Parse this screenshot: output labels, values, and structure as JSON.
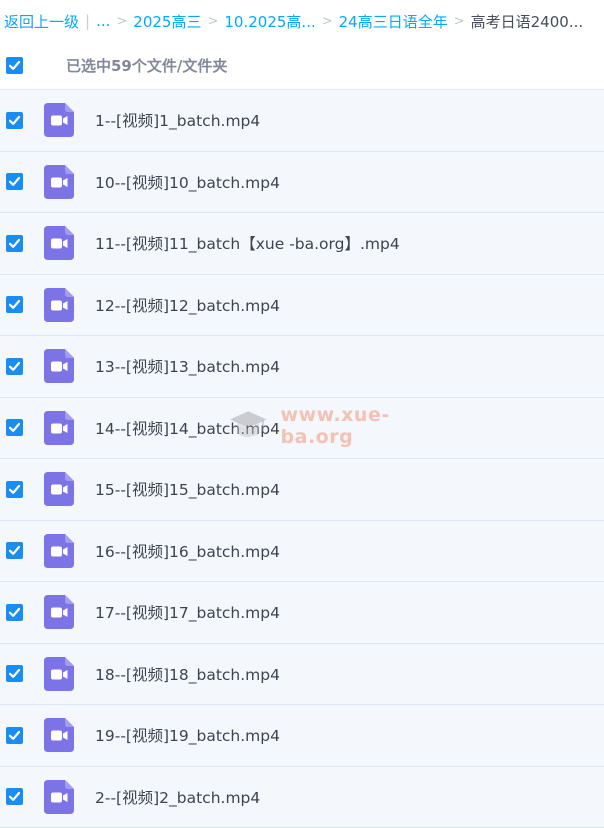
{
  "breadcrumb": {
    "back": "返回上一级",
    "ellipsis": "...",
    "items": [
      "2025高三",
      "10.2025高...",
      "24高三日语全年"
    ],
    "current": "高考日语2400..."
  },
  "selection": {
    "label": "已选中59个文件/文件夹",
    "checked": true
  },
  "files": [
    {
      "name": "1--[视频]1_batch.mp4"
    },
    {
      "name": "10--[视频]10_batch.mp4"
    },
    {
      "name": "11--[视频]11_batch【xue -ba.org】.mp4"
    },
    {
      "name": "12--[视频]12_batch.mp4"
    },
    {
      "name": "13--[视频]13_batch.mp4"
    },
    {
      "name": "14--[视频]14_batch.mp4"
    },
    {
      "name": "15--[视频]15_batch.mp4"
    },
    {
      "name": "16--[视频]16_batch.mp4"
    },
    {
      "name": "17--[视频]17_batch.mp4"
    },
    {
      "name": "18--[视频]18_batch.mp4"
    },
    {
      "name": "19--[视频]19_batch.mp4"
    },
    {
      "name": "2--[视频]2_batch.mp4"
    }
  ],
  "watermark": {
    "text": "www.xue-ba.org"
  },
  "colors": {
    "accent": "#06a7ff",
    "checkbox": "#1a8df2",
    "video_icon": "#7c73e6",
    "row_bg": "#f4f8fd"
  }
}
